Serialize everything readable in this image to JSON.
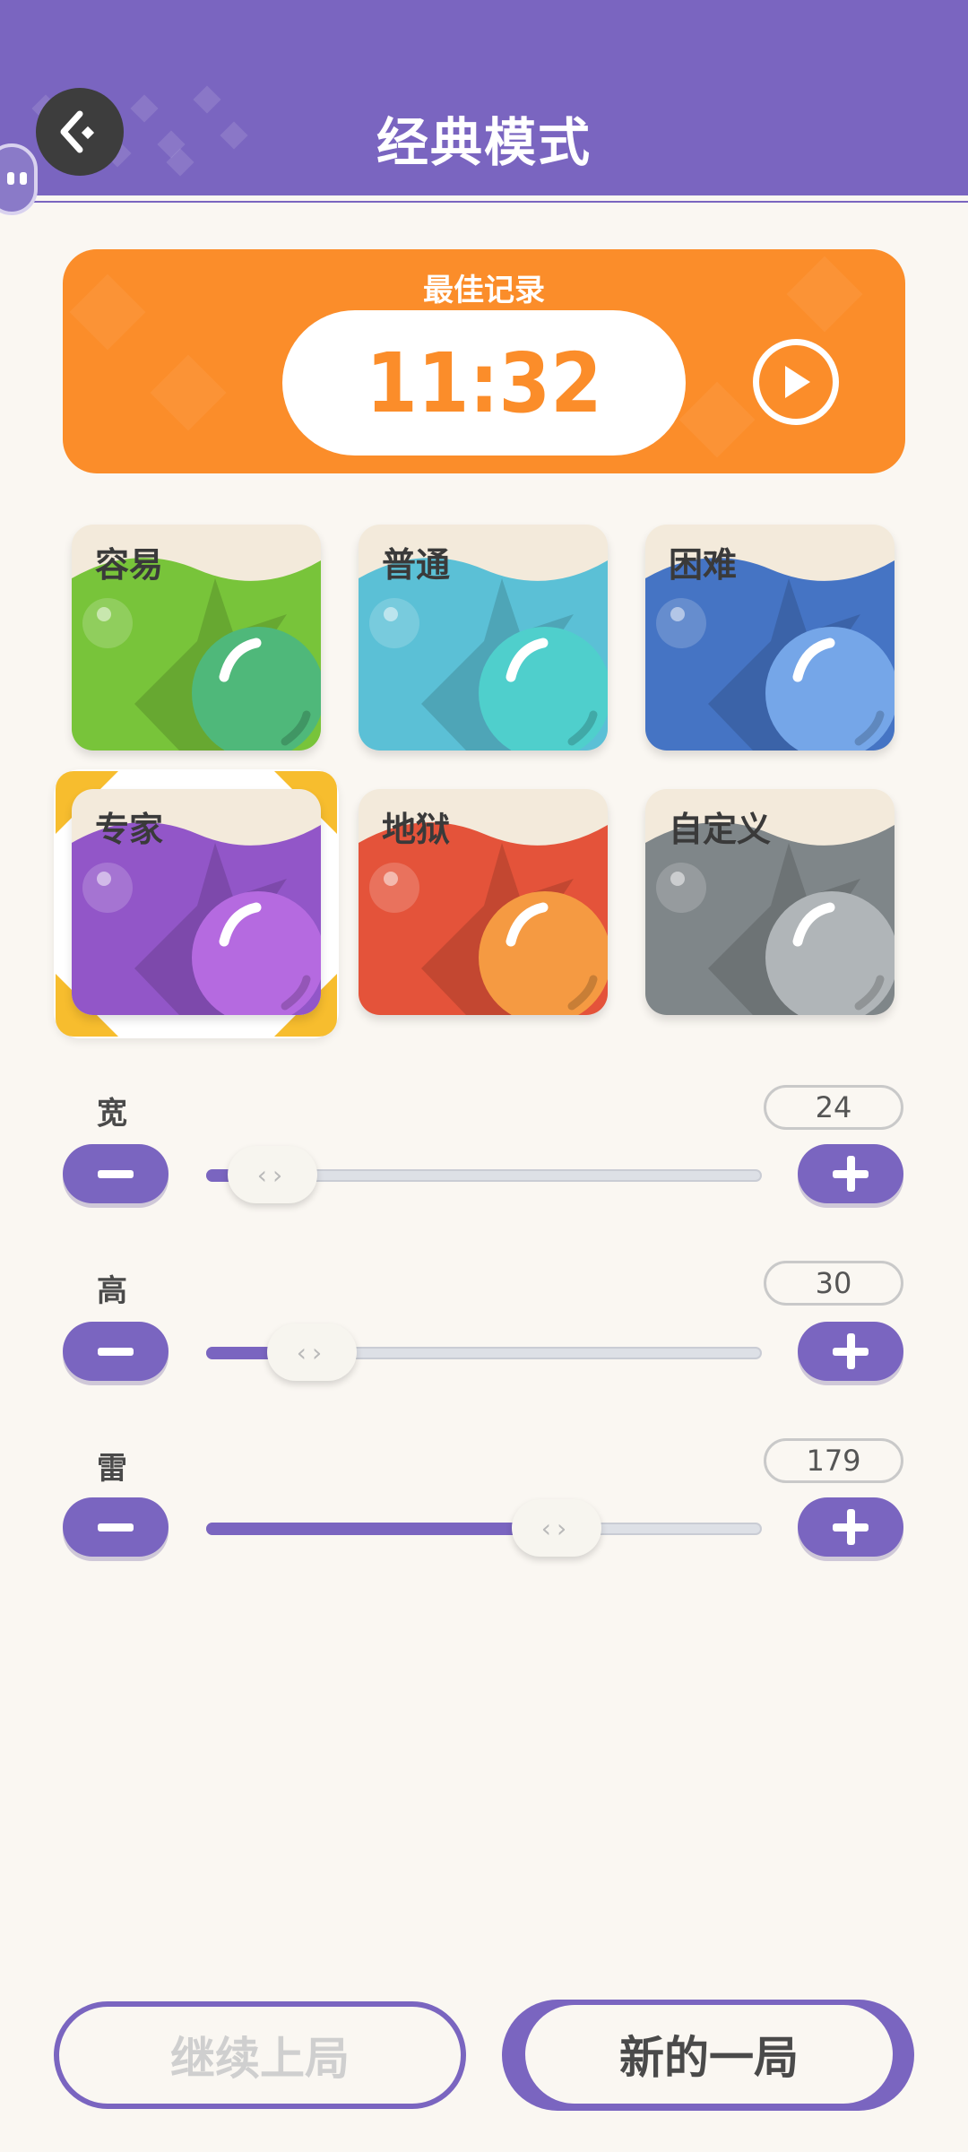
{
  "header": {
    "title": "经典模式"
  },
  "best_record": {
    "label": "最佳记录",
    "time": "11:32"
  },
  "difficulties": [
    {
      "label": "容易",
      "color": "#78c43a",
      "orb": "#4fb87a",
      "selected": false
    },
    {
      "label": "普通",
      "color": "#5bc0d6",
      "orb": "#4fcfcc",
      "selected": false
    },
    {
      "label": "困难",
      "color": "#4574c4",
      "orb": "#75a6e8",
      "selected": false
    },
    {
      "label": "专家",
      "color": "#9256c8",
      "orb": "#b56ae0",
      "selected": true
    },
    {
      "label": "地狱",
      "color": "#e4533a",
      "orb": "#f59a42",
      "selected": false
    },
    {
      "label": "自定义",
      "color": "#7f8689",
      "orb": "#b0b5b8",
      "selected": false
    }
  ],
  "sliders": {
    "width": {
      "label": "宽",
      "value": "24",
      "level": 0.12
    },
    "height": {
      "label": "高",
      "value": "30",
      "level": 0.19
    },
    "mines": {
      "label": "雷",
      "value": "179",
      "level": 0.63
    }
  },
  "buttons": {
    "continue": "继续上局",
    "new_game": "新的一局"
  },
  "colors": {
    "accent": "#7a65c0",
    "best": "#fb8d2a",
    "highlight": "#f7bd2e"
  }
}
